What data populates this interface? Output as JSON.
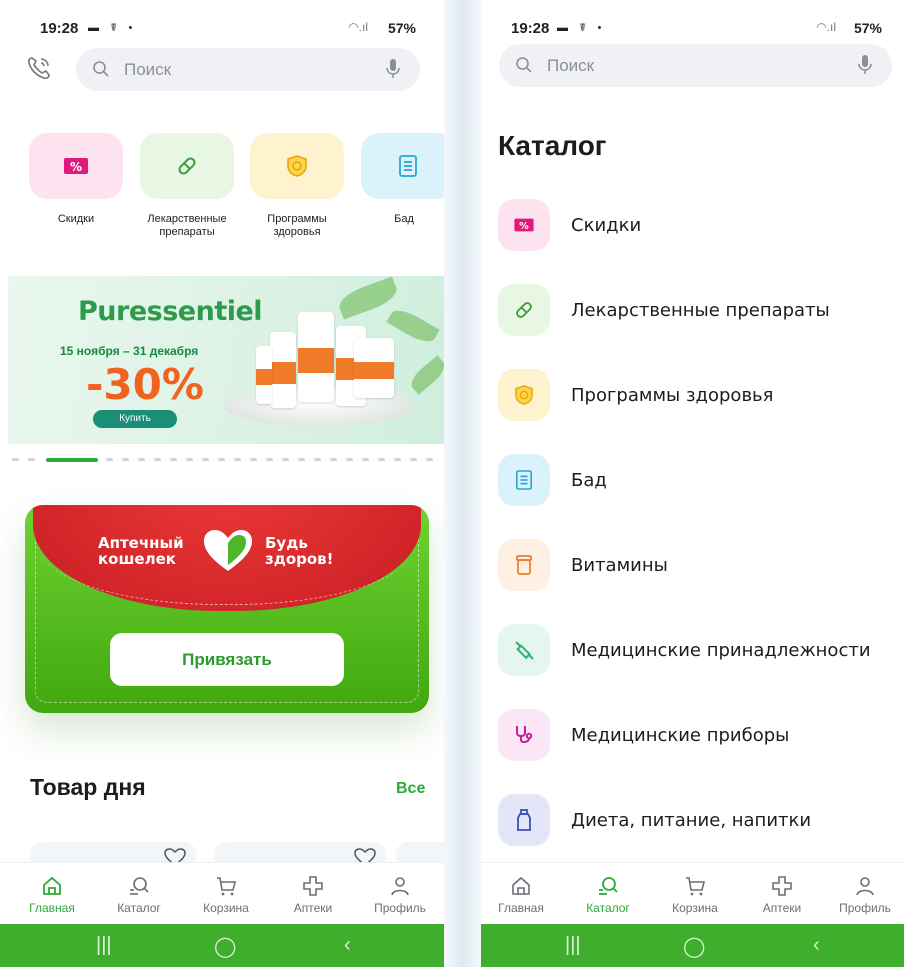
{
  "status": {
    "time": "19:28",
    "battery": "57%"
  },
  "search": {
    "placeholder": "Поиск"
  },
  "categories": [
    {
      "label": "Скидки",
      "color": "#fde3ef",
      "icon": "discount-icon"
    },
    {
      "label": "Лекарственные препараты",
      "color": "#e8f7e4",
      "icon": "pill-icon"
    },
    {
      "label": "Программы здоровья",
      "color": "#fff3cf",
      "icon": "shield-icon"
    },
    {
      "label": "Бад",
      "color": "#dcf2fb",
      "icon": "supplement-icon"
    }
  ],
  "banner": {
    "brand": "Puressentiel",
    "dates": "15 ноября – 31 декабря",
    "discount": "-30%",
    "buy": "Купить"
  },
  "wallet": {
    "line1a": "Аптечный",
    "line1b": "кошелек",
    "line2a": "Будь",
    "line2b": "здоров!",
    "bind": "Привязать"
  },
  "product_of_day": {
    "title": "Товар дня",
    "all": "Все"
  },
  "nav": [
    {
      "label": "Главная",
      "icon": "home-icon"
    },
    {
      "label": "Каталог",
      "icon": "catalog-icon"
    },
    {
      "label": "Корзина",
      "icon": "cart-icon"
    },
    {
      "label": "Аптеки",
      "icon": "pharmacy-icon"
    },
    {
      "label": "Профиль",
      "icon": "profile-icon"
    }
  ],
  "catalog": {
    "title": "Каталог",
    "items": [
      {
        "label": "Скидки",
        "color": "#fde3ef",
        "icon": "discount-icon"
      },
      {
        "label": "Лекарственные препараты",
        "color": "#e8f7e4",
        "icon": "pill-icon"
      },
      {
        "label": "Программы здоровья",
        "color": "#fff3cf",
        "icon": "shield-icon"
      },
      {
        "label": "Бад",
        "color": "#dcf2fb",
        "icon": "supplement-icon"
      },
      {
        "label": "Витамины",
        "color": "#fff0e4",
        "icon": "vitamin-jar-icon"
      },
      {
        "label": "Медицинские принадлежности",
        "color": "#e4f6ee",
        "icon": "syringe-icon"
      },
      {
        "label": "Медицинские приборы",
        "color": "#fde6f5",
        "icon": "stethoscope-icon"
      },
      {
        "label": "Диета, питание, напитки",
        "color": "#e3e6f8",
        "icon": "bottle-icon"
      }
    ]
  },
  "colors": {
    "accent": "#2dab3a",
    "wallet_red": "#d62b2e",
    "wallet_green": "#55bf1f"
  }
}
